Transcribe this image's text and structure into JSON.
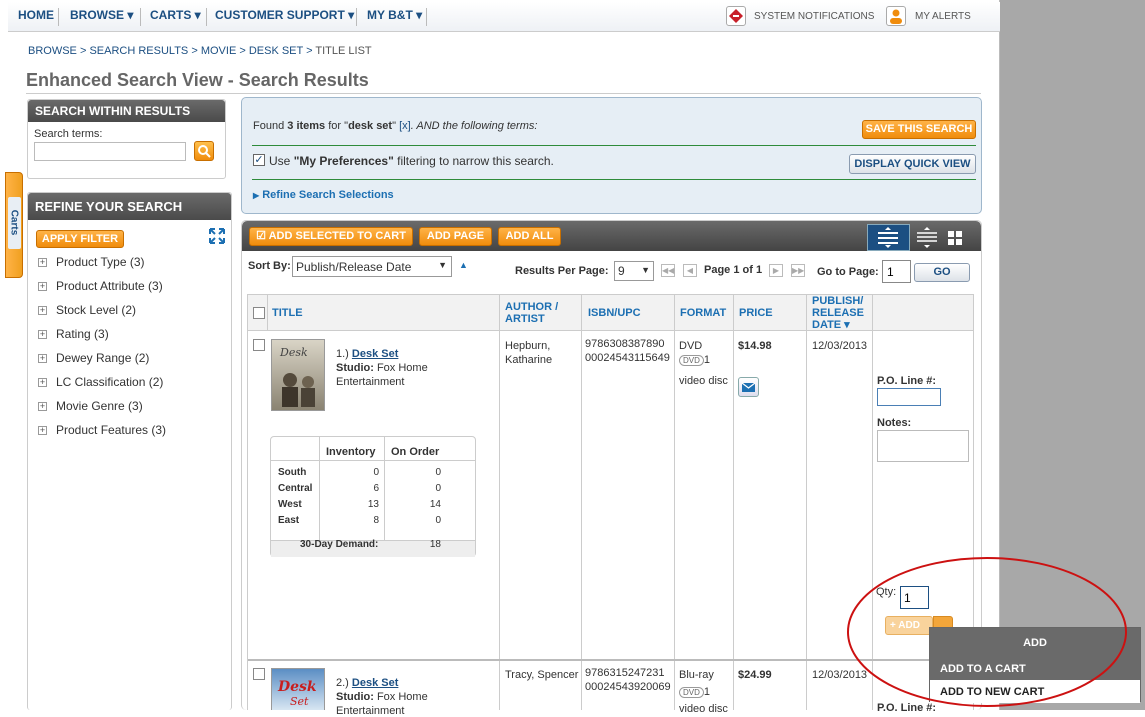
{
  "nav": {
    "items": [
      "HOME",
      "BROWSE ▾",
      "CARTS ▾",
      "CUSTOMER SUPPORT ▾",
      "MY B&T ▾"
    ],
    "system_notifications": "SYSTEM NOTIFICATIONS",
    "my_alerts": "MY ALERTS"
  },
  "breadcrumb": [
    "BROWSE",
    "SEARCH RESULTS",
    "MOVIE",
    "DESK SET",
    "TITLE LIST"
  ],
  "page_title": "Enhanced Search View - Search Results",
  "side_tab": "Carts",
  "search_within": {
    "heading": "SEARCH WITHIN RESULTS",
    "label": "Search terms:",
    "value": ""
  },
  "refine": {
    "heading": "REFINE YOUR SEARCH",
    "apply_label": "APPLY FILTER",
    "items": [
      "Product Type (3)",
      "Product Attribute (3)",
      "Stock Level (2)",
      "Rating (3)",
      "Dewey Range (2)",
      "LC Classification (2)",
      "Movie Genre (3)",
      "Product Features (3)"
    ]
  },
  "summary": {
    "found_prefix": "Found",
    "count": "3 items",
    "for_text": "for \"",
    "term": "desk set",
    "close_quote": "\"",
    "remove": "[x]",
    "and_text": ". AND the following terms:",
    "save_label": "SAVE THIS SEARCH",
    "use_text": "Use",
    "prefs": "\"My Preferences\"",
    "prefs_suffix": "filtering to narrow this search.",
    "prefs_checked": true,
    "quick_view_label": "DISPLAY QUICK VIEW",
    "refine_link": "Refine Search Selections"
  },
  "toolbar": {
    "add_selected": "ADD SELECTED TO CART",
    "add_page": "ADD PAGE",
    "add_all": "ADD ALL",
    "sort_label": "Sort By:",
    "sort_value": "Publish/Release Date",
    "rpp_label": "Results Per Page:",
    "rpp_value": "9",
    "page_prefix": "Page",
    "page_current": "1",
    "page_of": "of",
    "page_total": "1",
    "goto_label": "Go to Page:",
    "goto_value": "1",
    "go_label": "GO"
  },
  "columns": {
    "title": "TITLE",
    "author": "AUTHOR / ARTIST",
    "isbn": "ISBN/UPC",
    "format": "FORMAT",
    "price": "PRICE",
    "date": "PUBLISH/ RELEASE DATE ▾"
  },
  "results": [
    {
      "num": "1.)",
      "title": "Desk Set",
      "studio_label": "Studio:",
      "studio": "Fox Home",
      "studio2": "Entertainment",
      "author": "Hepburn,",
      "author2": "Katharine",
      "isbn": "9786308387890",
      "upc": "00024543115649",
      "format": "DVD",
      "format_icon": "DVD",
      "disc_count": "1",
      "format2": "video disc",
      "price": "$14.98",
      "date": "12/03/2013",
      "po_label": "P.O. Line #:",
      "notes_label": "Notes:",
      "qty_label": "Qty:",
      "qty": "1",
      "add_label": "+ ADD"
    },
    {
      "num": "2.)",
      "title": "Desk Set",
      "studio_label": "Studio:",
      "studio": "Fox Home",
      "studio2": "Entertainment",
      "author": "Tracy, Spencer",
      "isbn": "9786315247231",
      "upc": "00024543920069",
      "format": "Blu-ray",
      "format_icon": "DVD",
      "disc_count": "1",
      "format2": "video disc",
      "price": "$24.99",
      "date": "12/03/2013",
      "po_label": "P.O. Line #:"
    }
  ],
  "inventory": {
    "headers": [
      "",
      "Inventory",
      "On Order"
    ],
    "rows": [
      [
        "South",
        "0",
        "0"
      ],
      [
        "Central",
        "6",
        "0"
      ],
      [
        "West",
        "13",
        "14"
      ],
      [
        "East",
        "8",
        "0"
      ]
    ],
    "demand_label": "30-Day Demand:",
    "demand_value": "18"
  },
  "add_menu": {
    "header": "ADD",
    "items": [
      "ADD TO A CART",
      "ADD TO NEW CART"
    ]
  },
  "colors": {
    "accent_orange": "#f08c0c",
    "nav_blue": "#1c4f82",
    "link_blue": "#1c6fb2",
    "annotation_red": "#cc1111"
  }
}
